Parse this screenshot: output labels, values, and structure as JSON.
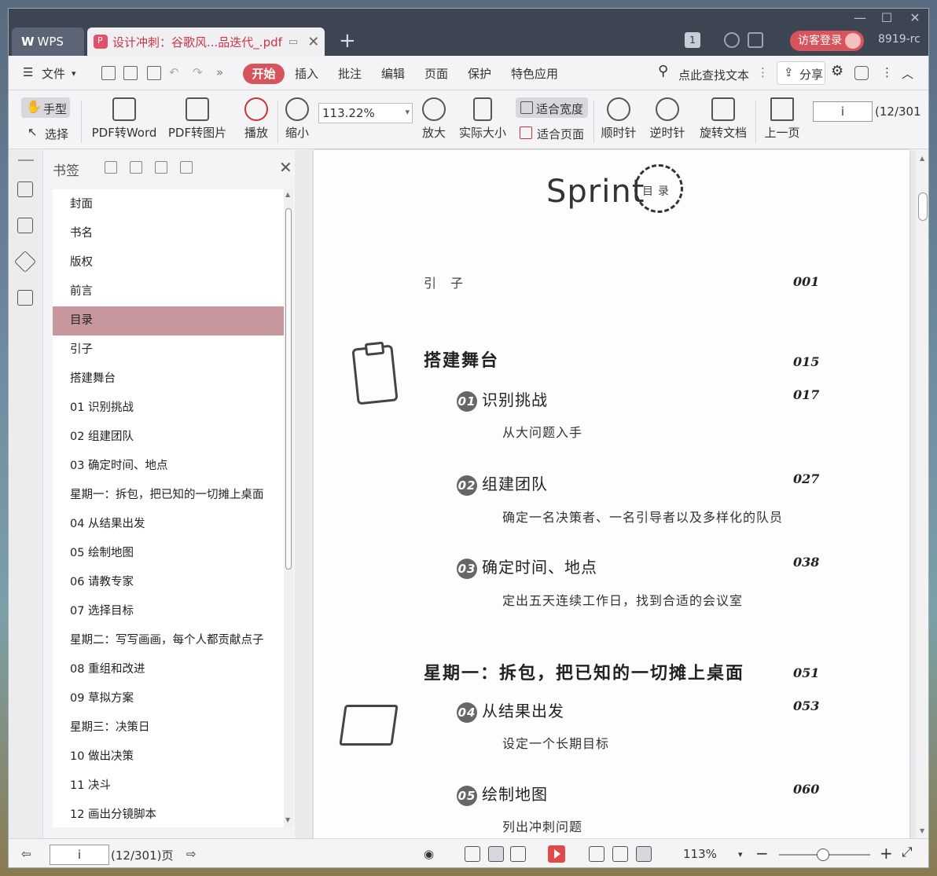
{
  "window": {
    "app_tab": "WPS",
    "doc_tab": "设计冲刺：谷歌风...品迭代_.pdf",
    "counter": "1",
    "login": "访客登录",
    "user_id": "8919-rc"
  },
  "menu": {
    "file": "文件",
    "items": [
      "开始",
      "插入",
      "批注",
      "编辑",
      "页面",
      "保护",
      "特色应用"
    ],
    "search": "点此查找文本",
    "share": "分享"
  },
  "toolbar": {
    "hand": "手型",
    "select": "选择",
    "pdf_to_word": "PDF转Word",
    "pdf_to_image": "PDF转图片",
    "play": "播放",
    "zoom_out": "缩小",
    "zoom_value": "113.22%",
    "zoom_in": "放大",
    "actual_size": "实际大小",
    "fit_width": "适合宽度",
    "fit_page": "适合页面",
    "clockwise": "顺时针",
    "counter_clockwise": "逆时针",
    "rotate_doc": "旋转文档",
    "prev_page": "上一页",
    "page_value": "i",
    "page_count": "(12/301"
  },
  "bookmarks": {
    "title": "书签",
    "items": [
      "封面",
      "书名",
      "版权",
      "前言",
      "目录",
      "引子",
      "搭建舞台",
      "01  识别挑战",
      "02  组建团队",
      "03  确定时间、地点",
      "星期一：拆包，把已知的一切摊上桌面",
      "04  从结果出发",
      "05  绘制地图",
      "06  请教专家",
      "07  选择目标",
      "星期二：写写画画，每个人都贡献点子",
      "08  重组和改进",
      "09  草拟方案",
      "星期三：决策日",
      "10  做出决策",
      "11  决斗",
      "12  画出分镜脚本"
    ],
    "selected_index": 4
  },
  "document": {
    "sprint": "Sprint",
    "mulu": "目录",
    "intro": {
      "title": "引子",
      "page": "001"
    },
    "part1": {
      "title": "搭建舞台",
      "page": "015"
    },
    "ch1": {
      "num": "01",
      "title": "识别挑战",
      "page": "017",
      "sub": "从大问题入手"
    },
    "ch2": {
      "num": "02",
      "title": "组建团队",
      "page": "027",
      "sub": "确定一名决策者、一名引导者以及多样化的队员"
    },
    "ch3": {
      "num": "03",
      "title": "确定时间、地点",
      "page": "038",
      "sub": "定出五天连续工作日，找到合适的会议室"
    },
    "part2": {
      "title": "星期一：拆包，把已知的一切摊上桌面",
      "page": "051"
    },
    "ch4": {
      "num": "04",
      "title": "从结果出发",
      "page": "053",
      "sub": "设定一个长期目标"
    },
    "ch5": {
      "num": "05",
      "title": "绘制地图",
      "page": "060",
      "sub": "列出冲刺问题"
    }
  },
  "statusbar": {
    "page_value": "i",
    "page_count": "(12/301)页",
    "zoom": "113%"
  }
}
